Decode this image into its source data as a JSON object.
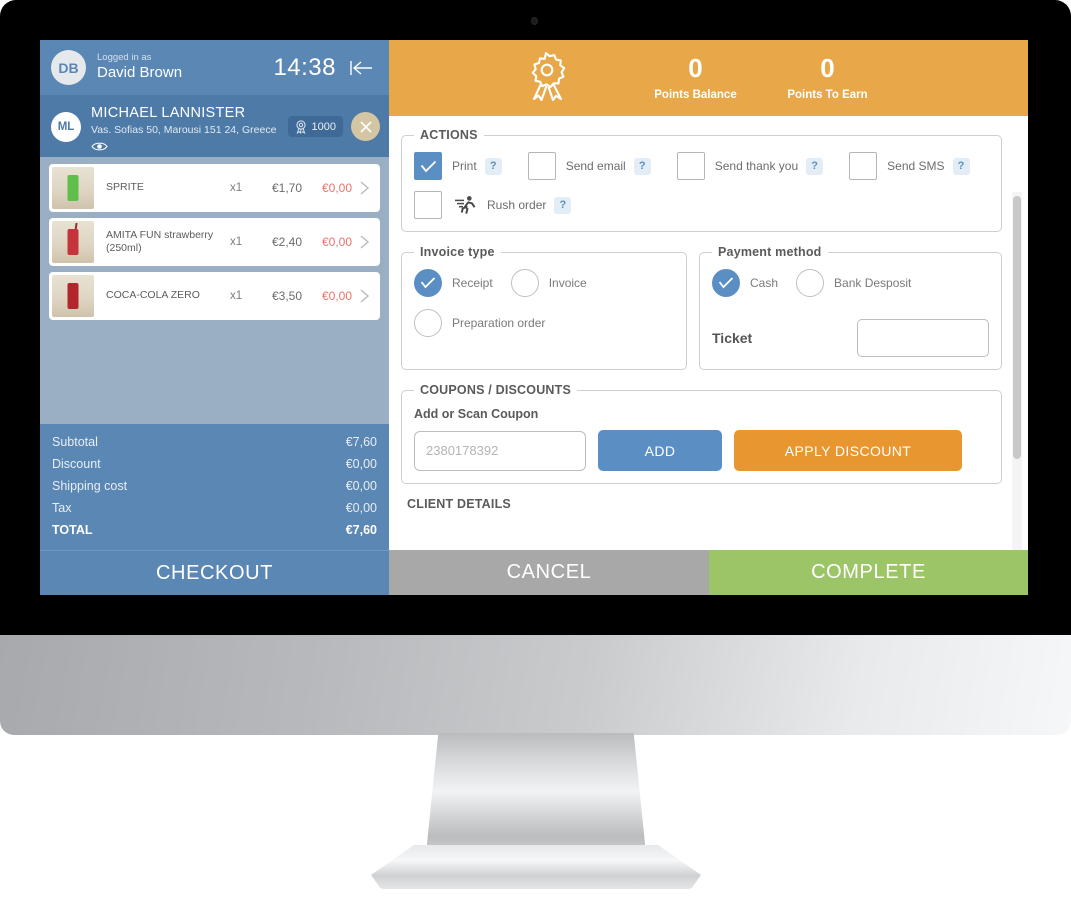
{
  "cart": {
    "user_bar": {
      "avatar_initials": "DB",
      "logged_in_label": "Logged in as",
      "user_name": "David Brown",
      "clock": "14:38",
      "back_icon": "back-to-start-icon"
    },
    "customer": {
      "avatar_initials": "ML",
      "name": "MICHAEL LANNISTER",
      "address": "Vas. Sofias 50, Marousi 151 24, Greece",
      "eye_icon": "eye-icon",
      "points_value": "1000",
      "points_icon": "rosette-icon",
      "close_icon": "close-icon"
    },
    "items": [
      {
        "name": "SPRITE",
        "qty": "x1",
        "price": "€1,70",
        "discount": "€0,00",
        "can_color": "#5fbf4a",
        "straw": false
      },
      {
        "name": "AMITA FUN strawberry (250ml)",
        "qty": "x1",
        "price": "€2,40",
        "discount": "€0,00",
        "can_color": "#c4343a",
        "straw": true
      },
      {
        "name": "COCA-COLA ZERO",
        "qty": "x1",
        "price": "€3,50",
        "discount": "€0,00",
        "can_color": "#b2252a",
        "straw": false
      }
    ],
    "totals": [
      {
        "label": "Subtotal",
        "value": "€7,60",
        "grand": false
      },
      {
        "label": "Discount",
        "value": "€0,00",
        "grand": false
      },
      {
        "label": "Shipping cost",
        "value": "€0,00",
        "grand": false
      },
      {
        "label": "Tax",
        "value": "€0,00",
        "grand": false
      },
      {
        "label": "TOTAL",
        "value": "€7,60",
        "grand": true
      }
    ],
    "checkout_label": "CHECKOUT"
  },
  "loyalty": {
    "icon": "rosette-icon",
    "points_balance_value": "0",
    "points_balance_label": "Points Balance",
    "points_to_earn_value": "0",
    "points_to_earn_label": "Points To Earn"
  },
  "actions": {
    "legend": "ACTIONS",
    "items": [
      {
        "label": "Print",
        "checked": true,
        "help": "?"
      },
      {
        "label": "Send email",
        "checked": false,
        "help": "?"
      },
      {
        "label": "Send thank you",
        "checked": false,
        "help": "?"
      },
      {
        "label": "Send SMS",
        "checked": false,
        "help": "?"
      }
    ],
    "rush": {
      "label": "Rush order",
      "checked": false,
      "help": "?",
      "icon": "running-person-icon"
    }
  },
  "invoice_type": {
    "legend": "Invoice type",
    "options": [
      {
        "label": "Receipt",
        "selected": true
      },
      {
        "label": "Invoice",
        "selected": false
      },
      {
        "label": "Preparation order",
        "selected": false
      }
    ]
  },
  "payment_method": {
    "legend": "Payment method",
    "options": [
      {
        "label": "Cash",
        "selected": true
      },
      {
        "label": "Bank Desposit",
        "selected": false
      }
    ],
    "ticket_label": "Ticket",
    "ticket_value": ""
  },
  "coupons": {
    "legend": "COUPONS / DISCOUNTS",
    "subtitle": "Add or Scan Coupon",
    "input_placeholder": "2380178392",
    "input_value": "",
    "add_label": "ADD",
    "apply_label": "APPLY DISCOUNT"
  },
  "client_details": {
    "title": "CLIENT DETAILS"
  },
  "footer": {
    "cancel_label": "CANCEL",
    "complete_label": "COMPLETE"
  },
  "colors": {
    "brand_blue": "#5b87b4",
    "cart_bg": "#9bafc4",
    "loyalty_orange": "#e8a849",
    "accent_blue": "#5b8fc4",
    "apply_orange": "#e8962f",
    "complete_green": "#9cc567",
    "cancel_gray": "#a8a8a8",
    "discount_red": "#e8736b"
  }
}
